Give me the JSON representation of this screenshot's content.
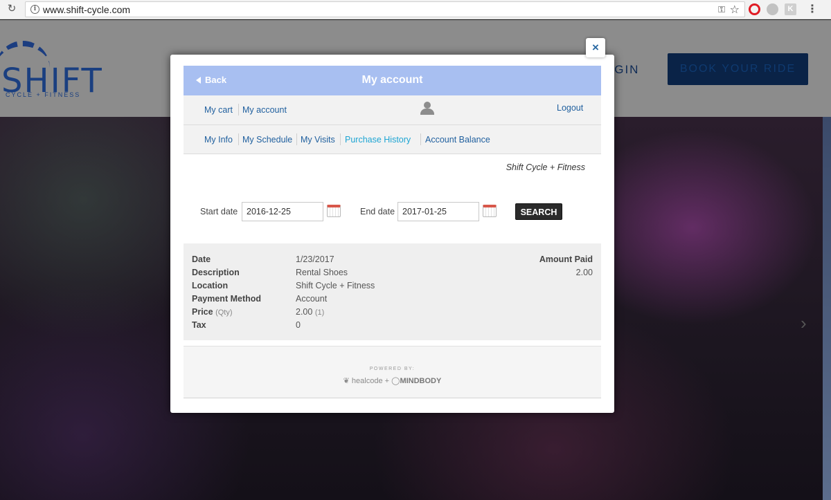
{
  "browser": {
    "url": "www.shift-cycle.com"
  },
  "site": {
    "logo_text": "SHIFT",
    "logo_sub": "CYCLE + FITNESS",
    "login_label": "OGIN",
    "book_label": "BOOK YOUR RIDE"
  },
  "modal": {
    "close_label": "×",
    "back_label": "Back",
    "title": "My account",
    "nav_top": {
      "cart": "My cart",
      "account": "My account",
      "logout": "Logout"
    },
    "nav_tabs": {
      "info": "My Info",
      "schedule": "My Schedule",
      "visits": "My Visits",
      "purchase_history": "Purchase History",
      "balance": "Account Balance"
    },
    "studio_name": "Shift Cycle + Fitness",
    "filters": {
      "start_label": "Start date",
      "start_value": "2016-12-25",
      "end_label": "End date",
      "end_value": "2017-01-25",
      "search_label": "SEARCH"
    },
    "purchase": {
      "labels": {
        "date": "Date",
        "description": "Description",
        "location": "Location",
        "payment_method": "Payment Method",
        "price": "Price",
        "qty": "(Qty)",
        "tax": "Tax",
        "amount_paid": "Amount Paid"
      },
      "values": {
        "date": "1/23/2017",
        "description": "Rental Shoes",
        "location": "Shift Cycle + Fitness",
        "payment_method": "Account",
        "price": "2.00",
        "qty": "(1)",
        "tax": "0",
        "amount_paid": "2.00"
      }
    },
    "footer": {
      "powered_by": "POWERED BY:",
      "healcode": "healcode",
      "plus": "+",
      "mindbody": "MINDBODY"
    }
  }
}
